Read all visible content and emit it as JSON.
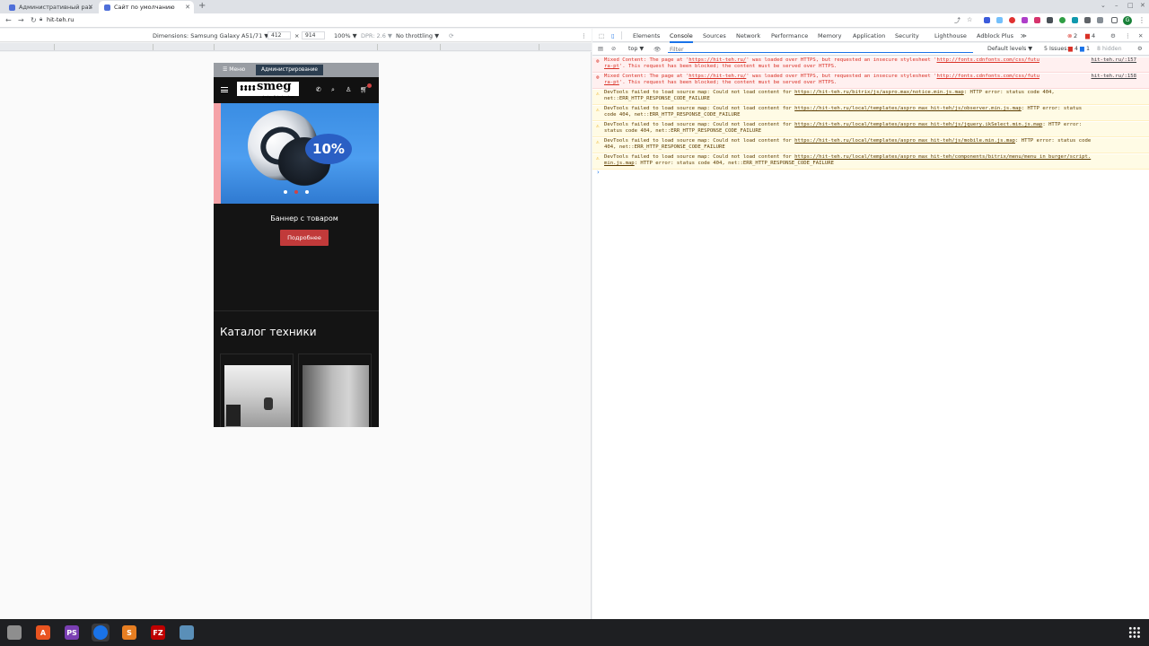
{
  "browser": {
    "tabs": [
      {
        "label": "Административный раз"
      },
      {
        "label": "Сайт по умолчанию"
      }
    ],
    "new_tab": "+",
    "url": "hit-teh.ru",
    "profile_initial": "G"
  },
  "device_toolbar": {
    "dimensions_label": "Dimensions: Samsung Galaxy A51/71 ▼",
    "width": "412",
    "times": "×",
    "height": "914",
    "zoom": "100% ▼",
    "dpr": "DPR: 2.6 ▼",
    "throttling": "No throttling ▼"
  },
  "site": {
    "admin_menu": "☰ Меню",
    "admin_button": "Администрирование",
    "logo_text": "smeg",
    "logo_sub": "design & technology",
    "banner_discount": "10%",
    "banner_title": "Баннер с товаром",
    "banner_button": "Подробнее",
    "catalog_title": "Каталог техники"
  },
  "devtools": {
    "tabs": [
      "Elements",
      "Console",
      "Sources",
      "Network",
      "Performance",
      "Memory",
      "Application",
      "Security",
      "Lighthouse",
      "Adblock Plus"
    ],
    "more": "≫",
    "context": "top ▼",
    "filter_placeholder": "Filter",
    "levels": "Default levels ▼",
    "issues": "5 Issues:",
    "issues_err": "4",
    "issues_info": "1",
    "hidden": "8 hidden",
    "badge_errors": "2",
    "badge_warnings": "4",
    "messages": [
      {
        "type": "err",
        "line1": "Mixed Content: The page at '<u>https://hit-teh.ru/</u>' was loaded over HTTPS, but requested an insecure stylesheet '<u>http://fonts.cdnfonts.com/css/futu</u>",
        "line2": "<u>ra-pt</u>'. This request has been blocked; the content must be served over HTTPS.",
        "source": "hit-teh.ru/:157"
      },
      {
        "type": "err",
        "line1": "Mixed Content: The page at '<u>https://hit-teh.ru/</u>' was loaded over HTTPS, but requested an insecure stylesheet '<u>http://fonts.cdnfonts.com/css/futu</u>",
        "line2": "<u>ra-pt</u>'. This request has been blocked; the content must be served over HTTPS.",
        "source": "hit-teh.ru/:158"
      },
      {
        "type": "warn",
        "line1": "DevTools failed to load source map: Could not load content for <u>https://hit-teh.ru/bitrix/js/aspro.max/notice.min.js.map</u>: HTTP error: status code 404,",
        "line2": "net::ERR_HTTP_RESPONSE_CODE_FAILURE",
        "source": ""
      },
      {
        "type": "warn",
        "line1": "DevTools failed to load source map: Could not load content for <u>https://hit-teh.ru/local/templates/aspro_max_hit-teh/js/observer.min.js.map</u>: HTTP error: status",
        "line2": "code 404, net::ERR_HTTP_RESPONSE_CODE_FAILURE",
        "source": ""
      },
      {
        "type": "warn",
        "line1": "DevTools failed to load source map: Could not load content for <u>https://hit-teh.ru/local/templates/aspro_max_hit-teh/js/jquery.ikSelect.min.js.map</u>: HTTP error:",
        "line2": "status code 404, net::ERR_HTTP_RESPONSE_CODE_FAILURE",
        "source": ""
      },
      {
        "type": "warn",
        "line1": "DevTools failed to load source map: Could not load content for <u>https://hit-teh.ru/local/templates/aspro_max_hit-teh/js/mobile.min.js.map</u>: HTTP error: status code",
        "line2": "404, net::ERR_HTTP_RESPONSE_CODE_FAILURE",
        "source": ""
      },
      {
        "type": "warn",
        "line1": "DevTools failed to load source map: Could not load content for <u>https://hit-teh.ru/local/templates/aspro_max_hit-teh/components/bitrix/menu/menu_in_burger/script.</u>",
        "line2": "<u>min.js.map</u>: HTTP error: status code 404, net::ERR_HTTP_RESPONSE_CODE_FAILURE",
        "source": ""
      }
    ],
    "prompt": "›"
  },
  "taskbar": {
    "apps": [
      {
        "label": "",
        "color": "#8e8e8e"
      },
      {
        "label": "A",
        "color": "#e95420"
      },
      {
        "label": "PS",
        "color": "#7a3fb3"
      },
      {
        "label": "",
        "color": "#1a73e8"
      },
      {
        "label": "S",
        "color": "#e67e22"
      },
      {
        "label": "FZ",
        "color": "#bf0000"
      },
      {
        "label": "",
        "color": "#5a8fb8"
      }
    ]
  },
  "colors": {
    "accent_button": "#c13a3a",
    "error_text": "#d93025",
    "devtools_link": "#1a73e8"
  }
}
